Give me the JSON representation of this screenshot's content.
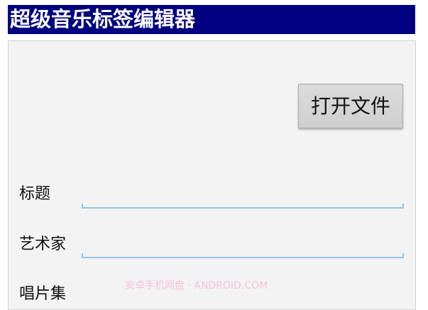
{
  "app": {
    "title": "超级音乐标签编辑器"
  },
  "toolbar": {
    "open_file_label": "打开文件"
  },
  "form": {
    "title_label": "标题",
    "title_value": "",
    "artist_label": "艺术家",
    "artist_value": "",
    "album_label": "唱片集"
  },
  "watermark": {
    "text": "安卓手机网盘 · ANDROID.COM"
  },
  "colors": {
    "title_bar": "#000080",
    "field_underline": "#8fc7e6",
    "panel_bg": "#f3f3f3"
  }
}
